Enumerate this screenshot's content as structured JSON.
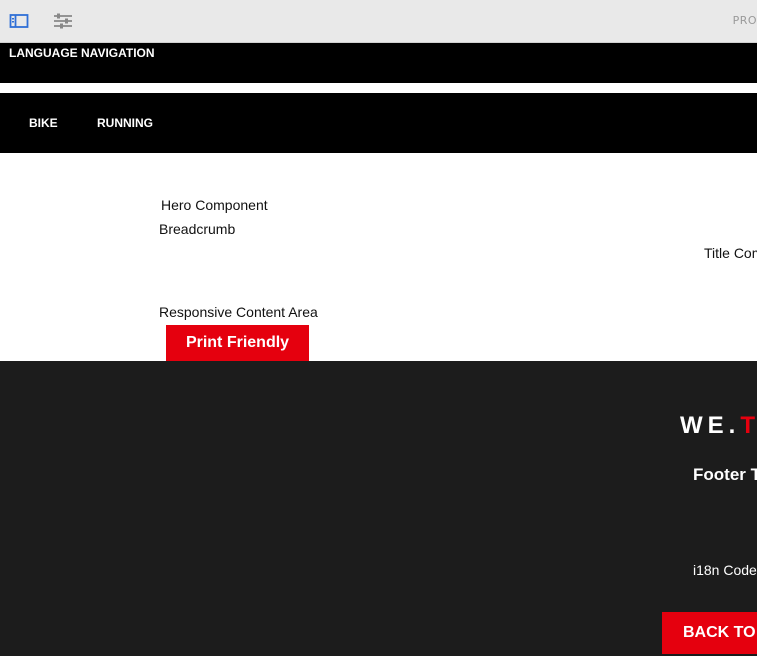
{
  "toolbar": {
    "icons": [
      "sidebar-toggle-icon",
      "sliders-icon"
    ],
    "right_label": "PRO"
  },
  "language_nav": {
    "label": "LANGUAGE NAVIGATION"
  },
  "main_nav": {
    "items": [
      {
        "label": "BIKE"
      },
      {
        "label": "RUNNING"
      }
    ]
  },
  "content": {
    "hero": "Hero Component",
    "breadcrumb": "Breadcrumb",
    "title": "Title Com",
    "responsive_area": "Responsive Content Area",
    "print_button": "Print Friendly"
  },
  "footer": {
    "logo_main": "WE.",
    "logo_accent": "T",
    "footer_title": "Footer T",
    "i18n_code": "i18n Code",
    "back_to_top": "BACK TO"
  },
  "colors": {
    "accent": "#e5000e",
    "toolbar_bg": "#e9e9e9",
    "nav_bg": "#000000",
    "footer_bg": "#1c1c1c",
    "toolbar_icon": "#2f6fd6"
  }
}
